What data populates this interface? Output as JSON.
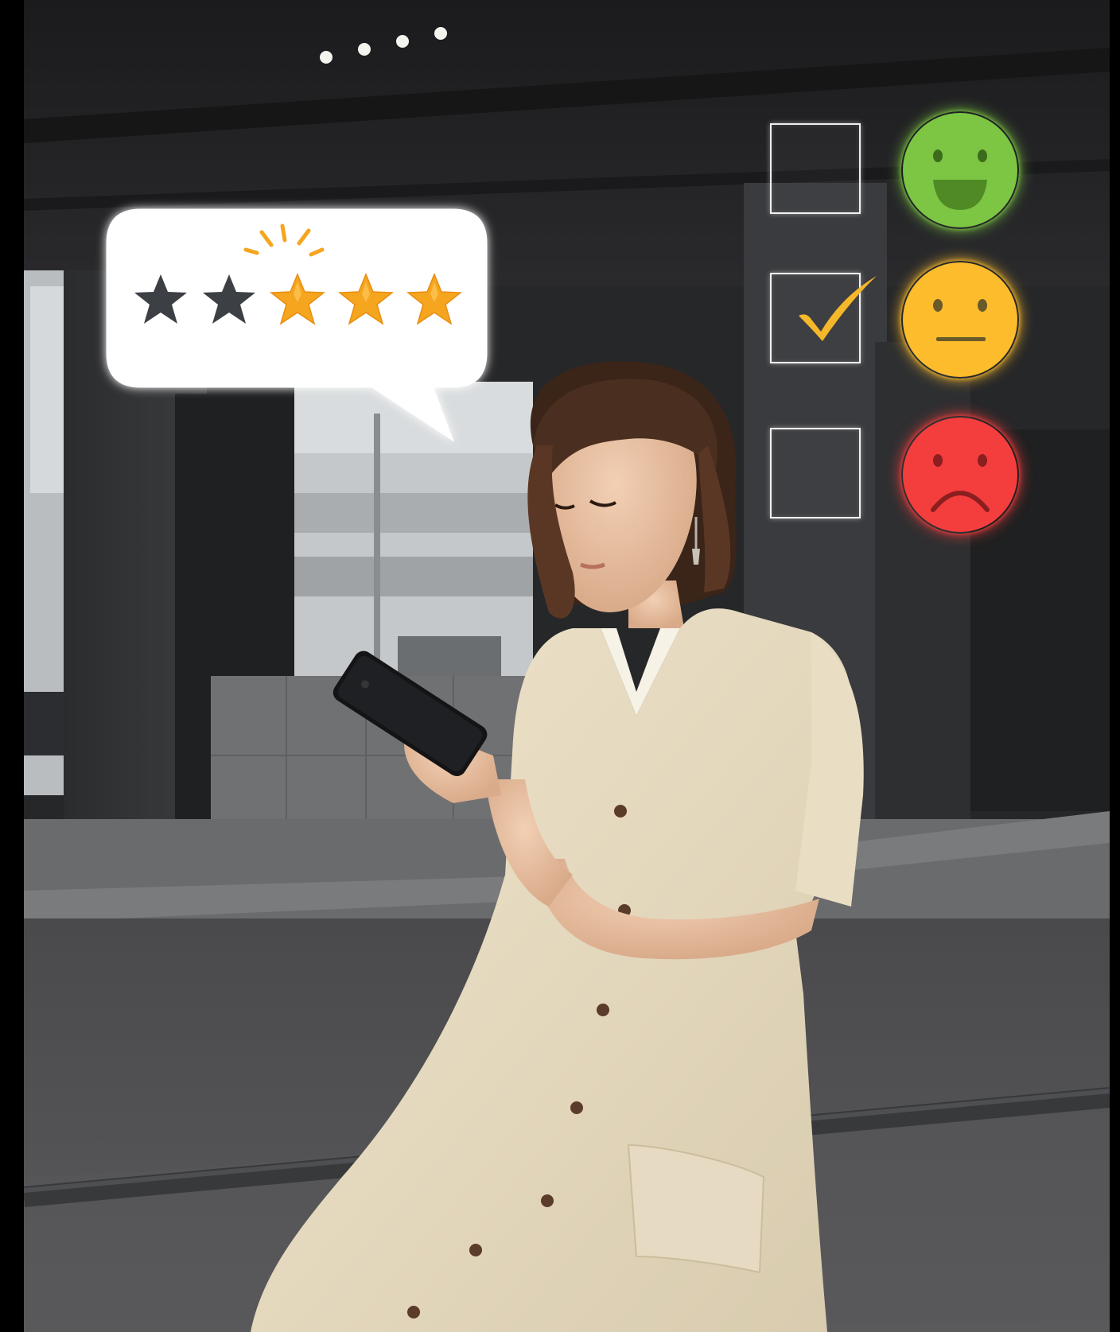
{
  "photo": {
    "subject": "woman-with-phone"
  },
  "rating": {
    "total_stars": 5,
    "stars_filled": 3,
    "filled_color": "#f5a51e",
    "empty_color": "#3c3f44",
    "bubble_color": "#ffffff"
  },
  "feedback": {
    "options": [
      {
        "icon": "happy-face-icon",
        "color": "#7cc644",
        "checked": false
      },
      {
        "icon": "neutral-face-icon",
        "color": "#fcbc2c",
        "checked": true
      },
      {
        "icon": "sad-face-icon",
        "color": "#f43d3d",
        "checked": false
      }
    ],
    "check_color": "#f5b82a"
  }
}
